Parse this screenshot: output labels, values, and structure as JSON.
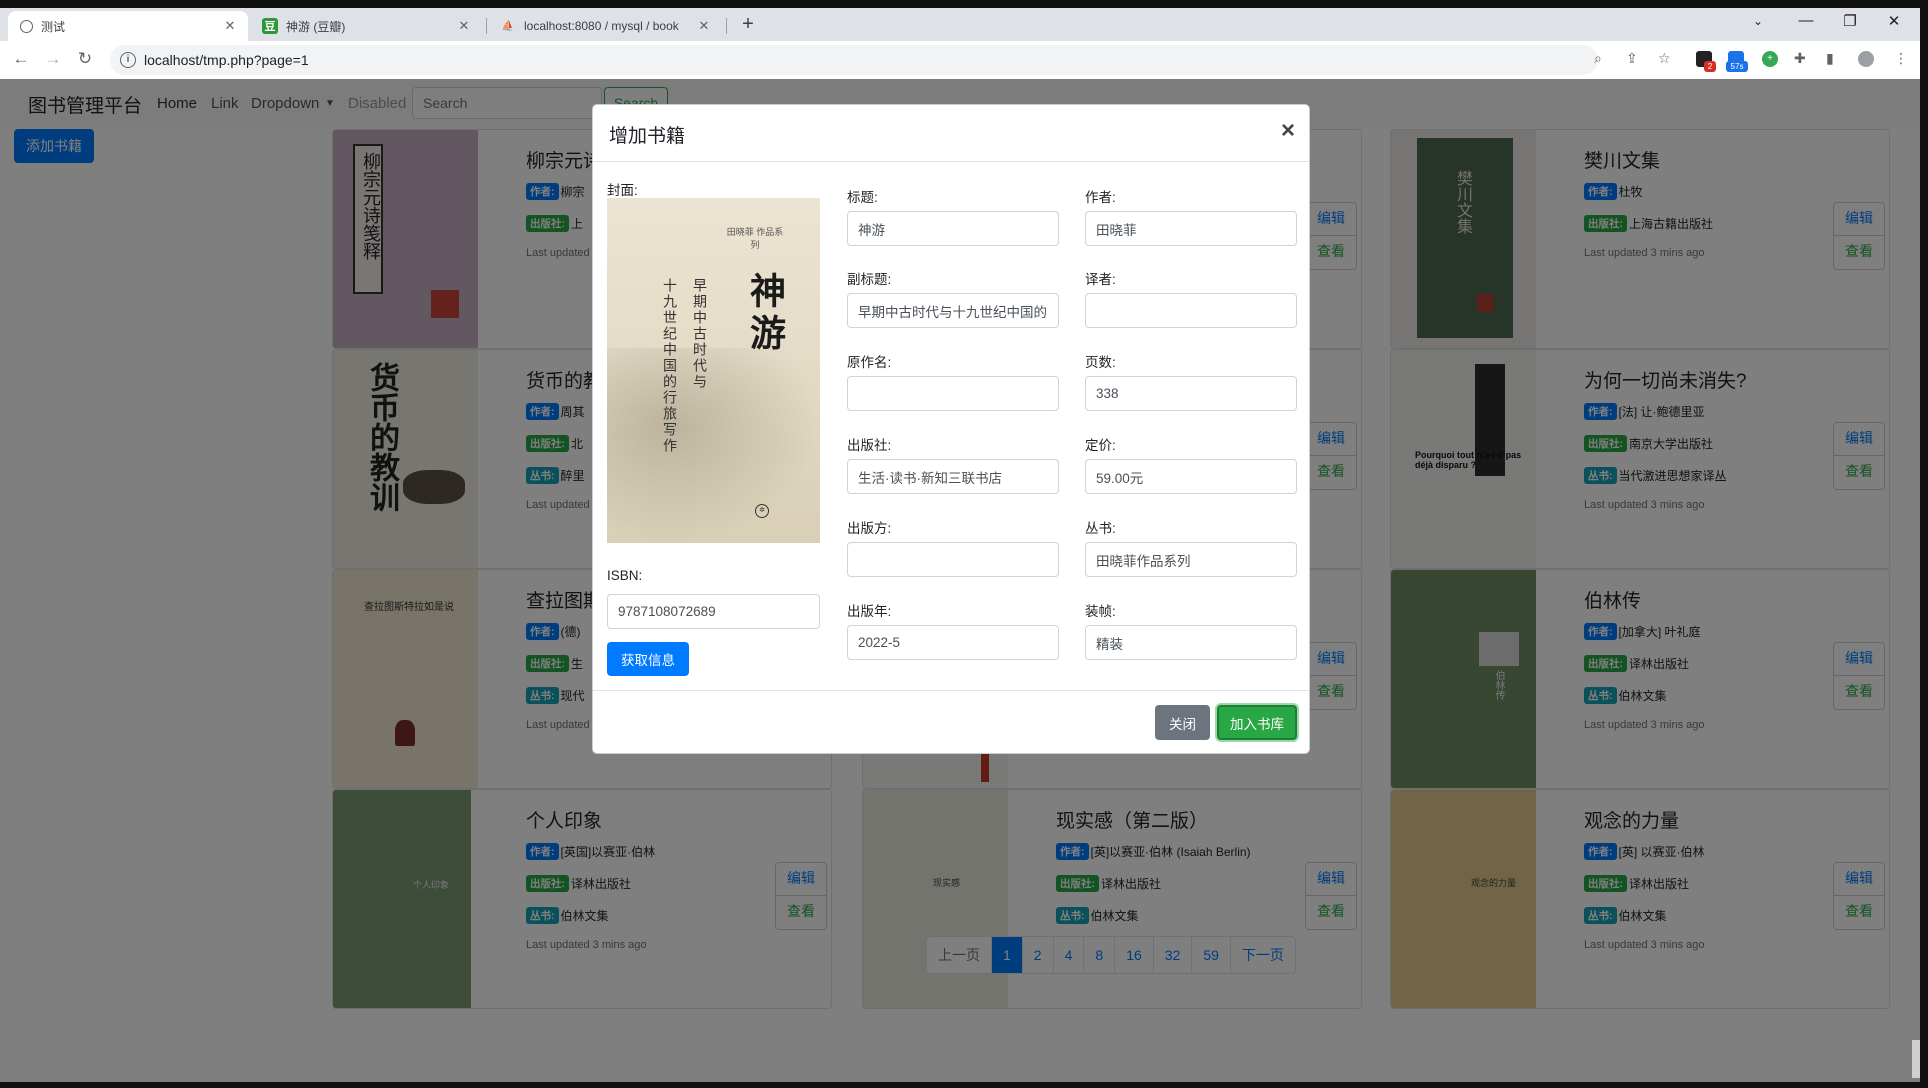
{
  "browser": {
    "tabs": [
      {
        "label": "测试",
        "icon": "globe-icon",
        "active": true
      },
      {
        "label": "神游 (豆瓣)",
        "icon": "douban-icon",
        "active": false
      },
      {
        "label": "localhost:8080 / mysql / book",
        "icon": "phpmyadmin-icon",
        "active": false
      }
    ],
    "url": "localhost/tmp.php?page=1",
    "extension_badges": [
      "2",
      "57s"
    ]
  },
  "site": {
    "brand": "图书管理平台",
    "nav": [
      "Home",
      "Link",
      "Dropdown",
      "Disabled"
    ],
    "search_placeholder": "Search",
    "search_button": "Search",
    "add_book_button": "添加书籍"
  },
  "labels": {
    "author": "作者:",
    "publisher": "出版社:",
    "series": "丛书:",
    "edit": "编辑",
    "view": "查看"
  },
  "books": [
    {
      "title": "柳宗元诗",
      "author": "柳宗",
      "publisher": "上",
      "series": "",
      "updated": "Last updated",
      "cover_text": "柳宗元诗笺释"
    },
    {
      "title": "樊川文集",
      "author": "杜牧",
      "publisher": "上海古籍出版社",
      "series": "",
      "updated": "Last updated 3 mins ago",
      "cover_text": "樊川文集"
    },
    {
      "title": "货币的教",
      "author": "周其",
      "publisher": "北",
      "series": "醉里",
      "updated": "Last updated",
      "cover_text": "货币的教训"
    },
    {
      "title": "为何一切尚未消失?",
      "author": "[法] 让·鲍德里亚",
      "publisher": "南京大学出版社",
      "series": "当代激进思想家译丛",
      "updated": "Last updated 3 mins ago",
      "cover_text": "Pourquoi tout n'a-t-il pas déjà disparu ?"
    },
    {
      "title": "查拉图斯",
      "author": "(德)",
      "publisher": "生",
      "series": "现代",
      "updated": "Last updated",
      "cover_text": "查拉图斯特拉如是说"
    },
    {
      "title": "伯林传",
      "author": "[加拿大] 叶礼庭",
      "publisher": "译林出版社",
      "series": "伯林文集",
      "updated": "Last updated 3 mins ago",
      "cover_text": "伯林传"
    },
    {
      "title": "个人印象",
      "author": "[英国]以赛亚·伯林",
      "publisher": "译林出版社",
      "series": "伯林文集",
      "updated": "Last updated 3 mins ago",
      "cover_text": "个人印象"
    },
    {
      "title": "现实感（第二版）",
      "author": "[英]以赛亚·伯林 (Isaiah Berlin)",
      "publisher": "译林出版社",
      "series": "伯林文集",
      "updated": "Last updated 3 mins ago",
      "cover_text": "现实感"
    },
    {
      "title": "观念的力量",
      "author": "[英] 以赛亚·伯林",
      "publisher": "译林出版社",
      "series": "伯林文集",
      "updated": "Last updated 3 mins ago",
      "cover_text": "观念的力量"
    }
  ],
  "pagination": [
    "上一页",
    "1",
    "2",
    "4",
    "8",
    "16",
    "32",
    "59",
    "下一页"
  ],
  "modal": {
    "title": "增加书籍",
    "cover_label": "封面:",
    "cover": {
      "top_text": "田晓菲 作品系列",
      "big_title": "神游",
      "subtitle_a": "早期中古时代与",
      "subtitle_b": "十九世纪中国的行旅写作"
    },
    "isbn_label": "ISBN:",
    "isbn_value": "9787108072689",
    "fetch_button": "获取信息",
    "fields": {
      "title": {
        "label": "标题:",
        "value": "神游"
      },
      "author": {
        "label": "作者:",
        "value": "田晓菲"
      },
      "subtitle": {
        "label": "副标题:",
        "value": "早期中古时代与十九世纪中国的"
      },
      "translator": {
        "label": "译者:",
        "value": ""
      },
      "original_title": {
        "label": "原作名:",
        "value": ""
      },
      "pages": {
        "label": "页数:",
        "value": "338"
      },
      "publisher": {
        "label": "出版社:",
        "value": "生活·读书·新知三联书店"
      },
      "price": {
        "label": "定价:",
        "value": "59.00元"
      },
      "producer": {
        "label": "出版方:",
        "value": ""
      },
      "series": {
        "label": "丛书:",
        "value": "田晓菲作品系列"
      },
      "pub_year": {
        "label": "出版年:",
        "value": "2022-5"
      },
      "binding": {
        "label": "装帧:",
        "value": "精装"
      }
    },
    "close_button": "关闭",
    "save_button": "加入书库"
  }
}
